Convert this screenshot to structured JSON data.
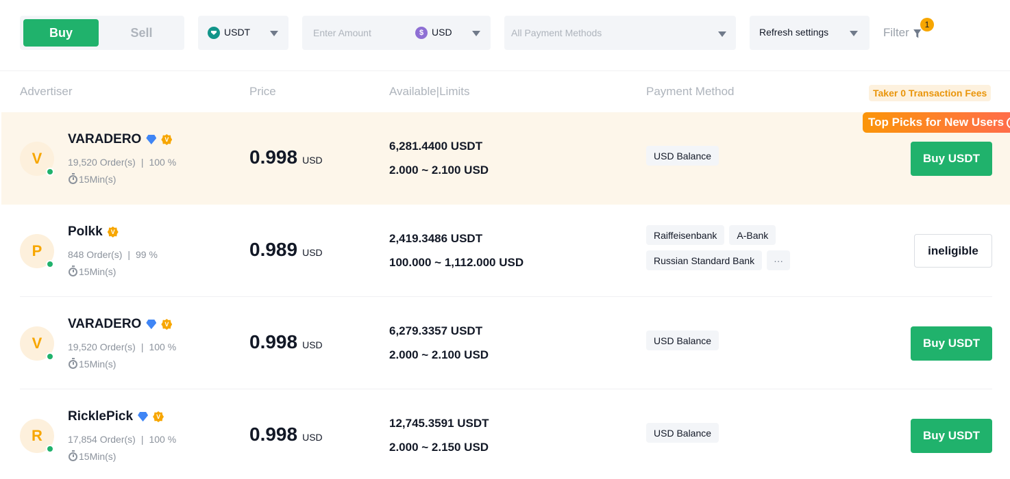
{
  "toolbar": {
    "buy_label": "Buy",
    "sell_label": "Sell",
    "crypto": {
      "icon": "usdt-icon",
      "label": "USDT"
    },
    "amount": {
      "placeholder": "Enter Amount",
      "value": "",
      "fiat_icon": "$",
      "fiat_label": "USD"
    },
    "payment_methods": {
      "placeholder": "All Payment Methods"
    },
    "refresh": {
      "label": "Refresh settings"
    },
    "filter": {
      "label": "Filter",
      "badge_count": "1"
    }
  },
  "table": {
    "headers": {
      "advertiser": "Advertiser",
      "price": "Price",
      "available_limits": "Available|Limits",
      "payment_method": "Payment Method"
    },
    "fees_badge": "Taker 0 Transaction Fees",
    "top_picks_label": "Top Picks for New Users",
    "top_picks_help_icon": "?",
    "more_icon": "···",
    "rows": [
      {
        "initial": "V",
        "name": "VARADERO",
        "verified": true,
        "vip_badge": "V",
        "orders": "19,520 Order(s)",
        "completion": "100 %",
        "time": "15Min(s)",
        "price": "0.998",
        "price_currency": "USD",
        "available": "6,281.4400 USDT",
        "limits": "2.000 ~ 2.100 USD",
        "payment_methods": [
          "USD Balance"
        ],
        "action": "Buy USDT",
        "highlighted": true
      },
      {
        "initial": "P",
        "name": "Polkk",
        "verified": false,
        "vip_badge": "V",
        "orders": "848 Order(s)",
        "completion": "99 %",
        "time": "15Min(s)",
        "price": "0.989",
        "price_currency": "USD",
        "available": "2,419.3486 USDT",
        "limits": "100.000 ~ 1,112.000 USD",
        "payment_methods": [
          "Raiffeisenbank",
          "A-Bank",
          "Russian Standard Bank"
        ],
        "has_more_methods": true,
        "action": "ineligible",
        "highlighted": false
      },
      {
        "initial": "V",
        "name": "VARADERO",
        "verified": true,
        "vip_badge": "V",
        "orders": "19,520 Order(s)",
        "completion": "100 %",
        "time": "15Min(s)",
        "price": "0.998",
        "price_currency": "USD",
        "available": "6,279.3357 USDT",
        "limits": "2.000 ~ 2.100 USD",
        "payment_methods": [
          "USD Balance"
        ],
        "action": "Buy USDT",
        "highlighted": false
      },
      {
        "initial": "R",
        "name": "RicklePick",
        "verified": true,
        "vip_badge": "V",
        "orders": "17,854 Order(s)",
        "completion": "100 %",
        "time": "15Min(s)",
        "price": "0.998",
        "price_currency": "USD",
        "available": "12,745.3591 USDT",
        "limits": "2.000 ~ 2.150 USD",
        "payment_methods": [
          "USD Balance"
        ],
        "action": "Buy USDT",
        "highlighted": false
      }
    ]
  },
  "colors": {
    "buy_green": "#20b26c",
    "accent_orange": "#f7a600",
    "verified_blue": "#3f85f5",
    "highlight_bg": "#fdf6ea"
  }
}
